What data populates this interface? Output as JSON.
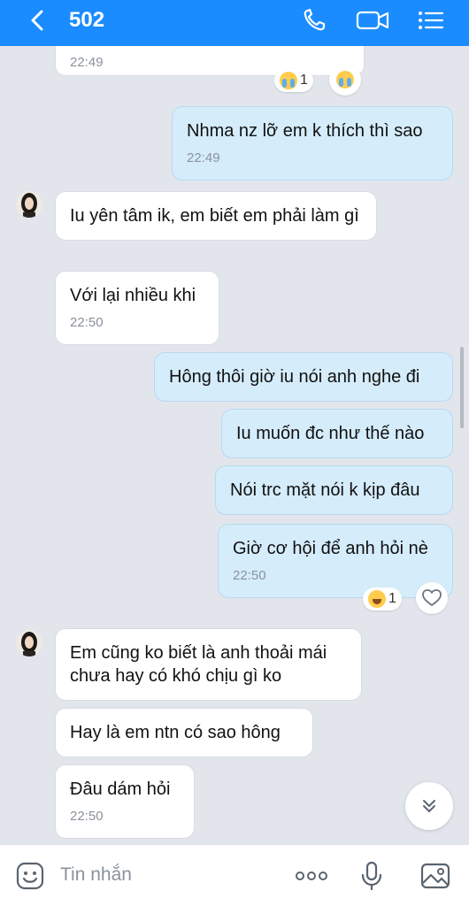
{
  "header": {
    "title": "502",
    "accent_color": "#1a8cff",
    "icons": [
      "back-icon",
      "phone-icon",
      "video-call-icon",
      "menu-list-icon"
    ]
  },
  "messages": [
    {
      "dir": "in",
      "time": "22:49"
    },
    {
      "dir": "out",
      "text": "Nhma nz lỡ em k thích thì sao",
      "time": "22:49"
    },
    {
      "dir": "in",
      "text": "Iu yên tâm ik, em biết em phải làm gì"
    },
    {
      "dir": "in",
      "text": "Với lại nhiều khi",
      "time": "22:50"
    },
    {
      "dir": "out",
      "text": "Hông thôi giờ iu nói anh nghe đi"
    },
    {
      "dir": "out",
      "text": "Iu muốn đc như thế nào"
    },
    {
      "dir": "out",
      "text": "Nói trc mặt nói k kịp đâu"
    },
    {
      "dir": "out",
      "text": "Giờ cơ hội để anh hỏi nè",
      "time": "22:50"
    },
    {
      "dir": "in",
      "text": "Em cũng ko biết là anh thoải mái chưa hay có khó chịu gì ko"
    },
    {
      "dir": "in",
      "text": "Hay là em ntn có sao hông"
    },
    {
      "dir": "in",
      "text": "Đâu dám hỏi",
      "time": "22:50"
    }
  ],
  "reactions": [
    {
      "emoji": "crying-face-icon",
      "count": "1"
    },
    {
      "emoji": "laughing-face-icon",
      "count": "1"
    }
  ],
  "composer": {
    "placeholder": "Tin nhắn",
    "icons": [
      "sticker-icon",
      "more-options-icon",
      "microphone-icon",
      "image-icon"
    ]
  }
}
